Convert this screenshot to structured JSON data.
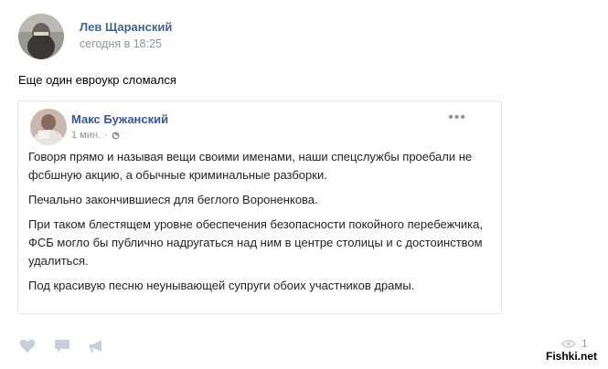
{
  "post": {
    "author_name": "Лев Щаранский",
    "time": "сегодня в 18:25",
    "text": "Еще один евроукр сломался"
  },
  "repost": {
    "author_name": "Макс Бужанский",
    "time": "1 мин.",
    "separator": "·",
    "more_label": "•••",
    "paragraphs": [
      "Говоря прямо и называя вещи своими именами, наши спецслужбы проебали не фсбшную акцию, а обычные криминальные разборки.",
      "Печально закончившиеся для беглого Вороненкова.",
      "При таком блестящем уровне обеспечения безопасности покойного перебежчика, ФСБ могло бы публично надругаться над ним в центре столицы и с достоинством удалиться.",
      "Под красивую песню неунывающей супруги обоих участников драмы."
    ]
  },
  "actions": {
    "like_icon": "heart-icon",
    "comment_icon": "comment-icon",
    "share_icon": "megaphone-icon",
    "views_icon": "eye-icon",
    "views_count": "1"
  },
  "watermark": "Fishki.net",
  "colors": {
    "author_link": "#42648b",
    "repost_link": "#365899",
    "muted": "#939393",
    "icon": "#c5d0db"
  }
}
